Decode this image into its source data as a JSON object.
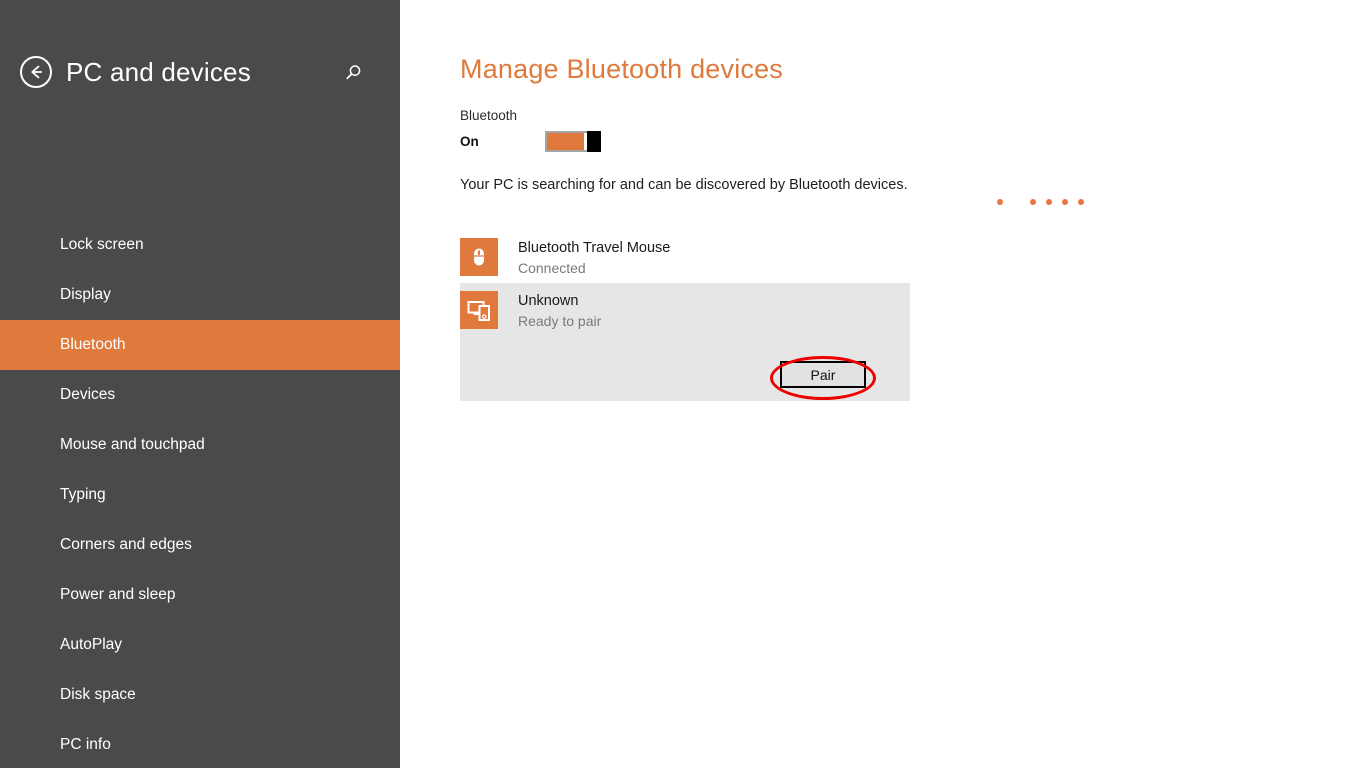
{
  "sidebar": {
    "back_icon": "back-arrow-icon",
    "title": "PC and devices",
    "search_icon": "search-icon",
    "accent_color": "#e0793c",
    "background_color": "#4a4a4a",
    "items": [
      {
        "label": "Lock screen",
        "selected": false
      },
      {
        "label": "Display",
        "selected": false
      },
      {
        "label": "Bluetooth",
        "selected": true
      },
      {
        "label": "Devices",
        "selected": false
      },
      {
        "label": "Mouse and touchpad",
        "selected": false
      },
      {
        "label": "Typing",
        "selected": false
      },
      {
        "label": "Corners and edges",
        "selected": false
      },
      {
        "label": "Power and sleep",
        "selected": false
      },
      {
        "label": "AutoPlay",
        "selected": false
      },
      {
        "label": "Disk space",
        "selected": false
      },
      {
        "label": "PC info",
        "selected": false
      }
    ]
  },
  "main": {
    "title": "Manage Bluetooth devices",
    "title_color": "#e0793c",
    "bluetooth_setting": {
      "label": "Bluetooth",
      "state": "On",
      "toggle_on": true
    },
    "status_message": "Your PC is searching for and can be discovered by Bluetooth devices.",
    "progress_dots": {
      "count": 5,
      "color": "#e0793c"
    },
    "devices": [
      {
        "name": "Bluetooth Travel Mouse",
        "status": "Connected",
        "icon": "bluetooth-mouse-icon",
        "selected": false,
        "action": null
      },
      {
        "name": "Unknown",
        "status": "Ready to pair",
        "icon": "unknown-device-icon",
        "selected": true,
        "action": "Pair"
      }
    ]
  },
  "annotation": {
    "shape": "ellipse",
    "color": "#ee0000",
    "target": "Pair"
  }
}
